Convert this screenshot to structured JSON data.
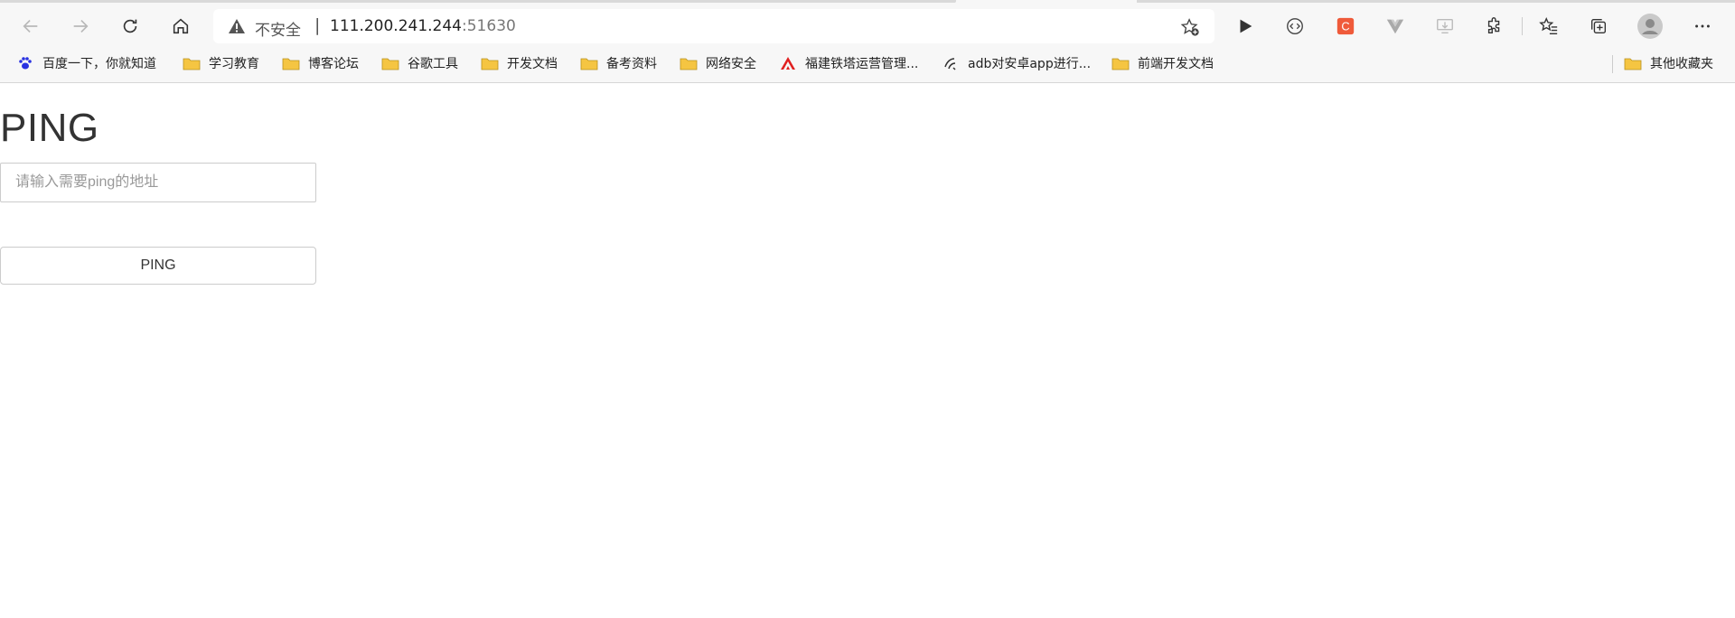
{
  "browser": {
    "address": {
      "security_label": "不安全",
      "separator": "|",
      "host": "111.200.241.244",
      "port": ":51630"
    },
    "bookmarks": [
      {
        "label": "百度一下，你就知道",
        "icon": "baidu-paw-icon"
      },
      {
        "label": "学习教育",
        "icon": "folder-icon"
      },
      {
        "label": "博客论坛",
        "icon": "folder-icon"
      },
      {
        "label": "谷歌工具",
        "icon": "folder-icon"
      },
      {
        "label": "开发文档",
        "icon": "folder-icon"
      },
      {
        "label": "备考资料",
        "icon": "folder-icon"
      },
      {
        "label": "网络安全",
        "icon": "folder-icon"
      },
      {
        "label": "福建铁塔运营管理...",
        "icon": "tower-logo-icon"
      },
      {
        "label": "adb对安卓app进行...",
        "icon": "site-icon"
      },
      {
        "label": "前端开发文档",
        "icon": "folder-icon"
      }
    ],
    "other_bookmarks": "其他收藏夹",
    "colors": {
      "folder": "#f5c542",
      "extension_red": "#ef5a3a",
      "tower_red": "#e02020"
    }
  },
  "page": {
    "title": "PING",
    "input_placeholder": "请输入需要ping的地址",
    "button_label": "PING"
  }
}
